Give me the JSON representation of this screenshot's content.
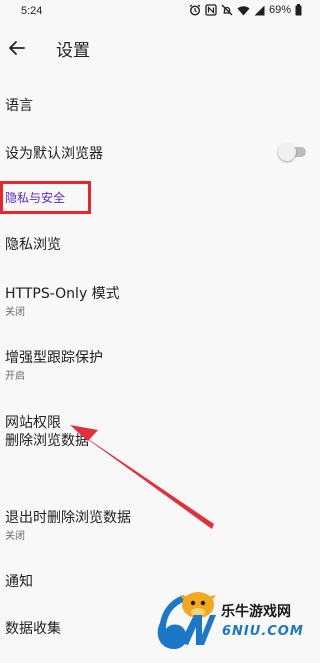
{
  "status_bar": {
    "time": "5:24",
    "battery": "69%",
    "icons": [
      "alarm-icon",
      "nfc-icon",
      "mute-icon",
      "wifi-icon",
      "signal-icon",
      "battery-icon"
    ]
  },
  "app_bar": {
    "title": "设置",
    "back_icon": "arrow-left-icon"
  },
  "items": {
    "language": {
      "title": "语言"
    },
    "default_browser": {
      "title": "设为默认浏览器",
      "toggle_on": false
    },
    "privacy_category": {
      "title": "隐私与安全"
    },
    "private_browsing": {
      "title": "隐私浏览"
    },
    "https_only": {
      "title": "HTTPS-Only 模式",
      "subtitle": "关闭"
    },
    "tracking_protection": {
      "title": "增强型跟踪保护",
      "subtitle": "开启"
    },
    "site_permissions": {
      "title": "网站权限"
    },
    "delete_browsing_data": {
      "title": "删除浏览数据"
    },
    "delete_on_quit": {
      "title": "退出时删除浏览数据",
      "subtitle": "关闭"
    },
    "notifications": {
      "title": "通知"
    },
    "data_collection": {
      "title": "数据收集"
    }
  },
  "annotation": {
    "box_color": "#e8262b",
    "arrow_color": "#e0313a"
  },
  "watermark": {
    "site_name": "乐牛游戏网",
    "domain_text": "6NIU.COM"
  },
  "colors": {
    "background": "#f8f8f8",
    "category_accent": "#592acb",
    "text_primary": "#1f1f1f",
    "text_secondary": "#6b6b6b"
  }
}
